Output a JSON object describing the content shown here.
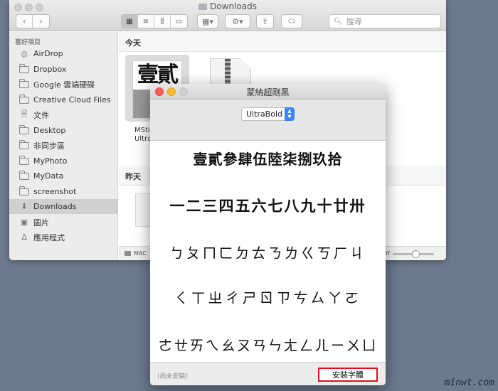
{
  "finder": {
    "title": "Downloads",
    "search_placeholder": "搜尋",
    "sidebar": {
      "section": "喜好項目",
      "items": [
        {
          "label": "AirDrop",
          "icon": "airdrop-icon"
        },
        {
          "label": "Dropbox",
          "icon": "folder-icon"
        },
        {
          "label": "Google 雲端硬碟",
          "icon": "folder-icon"
        },
        {
          "label": "Creative Cloud Files",
          "icon": "folder-icon"
        },
        {
          "label": "文件",
          "icon": "document-icon"
        },
        {
          "label": "Desktop",
          "icon": "folder-icon"
        },
        {
          "label": "非同步區",
          "icon": "folder-icon"
        },
        {
          "label": "MyPhoto",
          "icon": "folder-icon"
        },
        {
          "label": "MyData",
          "icon": "folder-icon"
        },
        {
          "label": "screenshot",
          "icon": "folder-icon"
        },
        {
          "label": "Downloads",
          "icon": "download-icon",
          "selected": true
        },
        {
          "label": "圖片",
          "icon": "camera-icon"
        },
        {
          "label": "應用程式",
          "icon": "applications-icon"
        }
      ]
    },
    "sections": {
      "today": "今天",
      "yesterday": "昨天"
    },
    "file_caption_line1": "MSti",
    "file_caption_line2": "Ultra",
    "thumb_glyphs": "壹貳",
    "status_left": "MAC",
    "status_right": "tf"
  },
  "font_window": {
    "title": "蒙納超剛黑",
    "style_value": "UltraBold",
    "samples": [
      "壹貳參肆伍陸柒捌玖拾",
      "一二三四五六七八九十廿卅",
      "ㄅㄆㄇㄈㄉㄊㄋㄌㄍㄎㄏㄐ",
      "ㄑㄒㄓㄔㄕㄖㄗㄘㄙㄚㄛ",
      "ㄜㄝㄞㄟㄠㄡㄢㄣㄤㄥㄦㄧㄨㄩ"
    ],
    "status": "(尚未安裝)",
    "install_label": "安裝字體"
  },
  "watermark": "minwt.com",
  "colors": {
    "desktop": "#6c7a8e",
    "highlight_box": "#d9141c",
    "select_accent": "#3a82f7"
  }
}
